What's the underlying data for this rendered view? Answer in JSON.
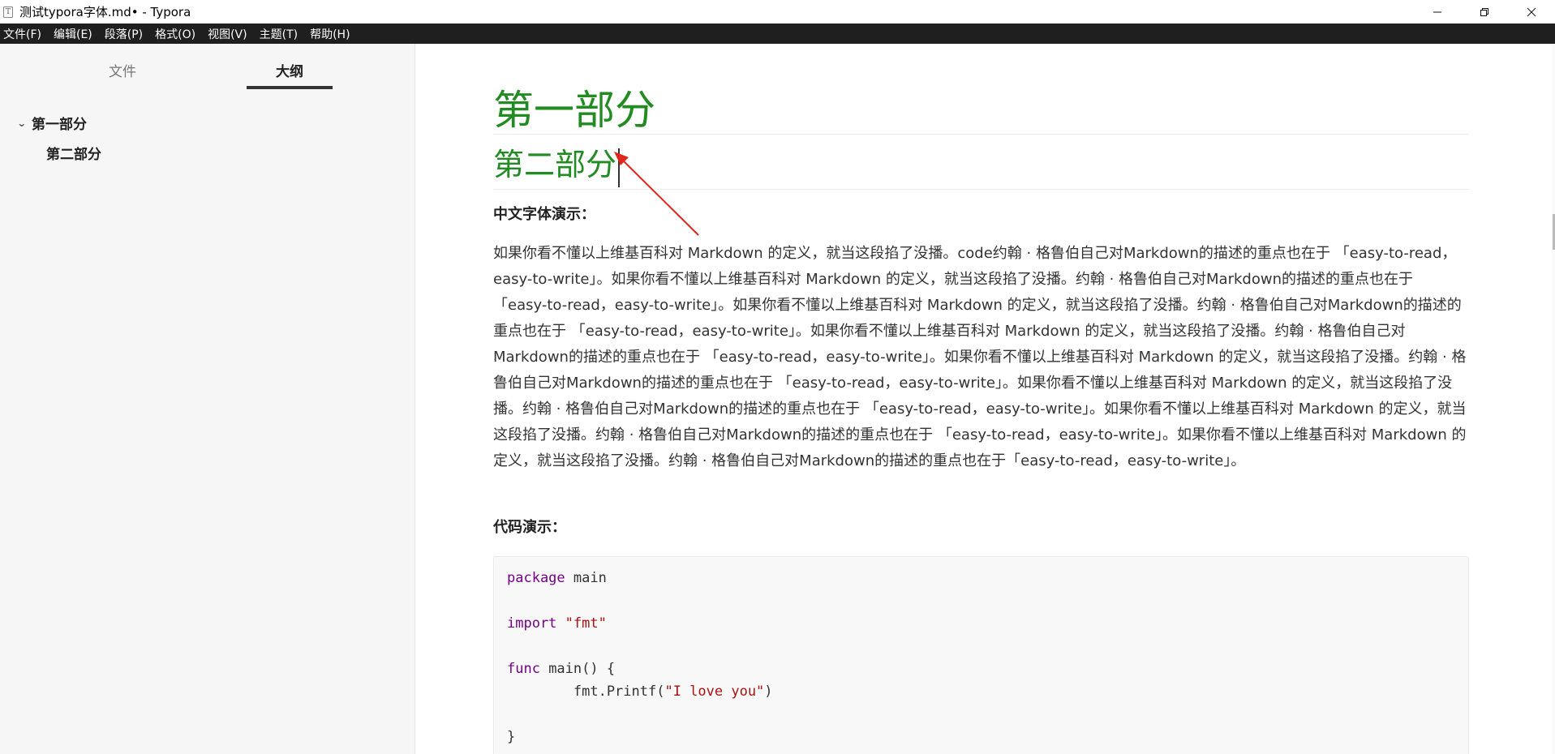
{
  "window": {
    "title": "测试typora字体.md• - Typora",
    "app_icon": "T"
  },
  "menubar": {
    "items": [
      "文件(F)",
      "编辑(E)",
      "段落(P)",
      "格式(O)",
      "视图(V)",
      "主题(T)",
      "帮助(H)"
    ]
  },
  "sidebar": {
    "tabs": {
      "files": "文件",
      "outline": "大纲"
    },
    "outline": [
      {
        "label": "第一部分",
        "expanded": true
      },
      {
        "label": "第二部分"
      }
    ]
  },
  "document": {
    "h1": "第一部分",
    "h2": "第二部分",
    "chinese_label": "中文字体演示：",
    "paragraph": "如果你看不懂以上维基百科对 Markdown 的定义，就当这段掐了没播。code约翰 · 格鲁伯自己对Markdown的描述的重点也在于 「easy-to-read，easy-to-write」。如果你看不懂以上维基百科对 Markdown 的定义，就当这段掐了没播。约翰 · 格鲁伯自己对Markdown的描述的重点也在于 「easy-to-read，easy-to-write」。如果你看不懂以上维基百科对 Markdown 的定义，就当这段掐了没播。约翰 · 格鲁伯自己对Markdown的描述的重点也在于 「easy-to-read，easy-to-write」。如果你看不懂以上维基百科对 Markdown 的定义，就当这段掐了没播。约翰 · 格鲁伯自己对Markdown的描述的重点也在于 「easy-to-read，easy-to-write」。如果你看不懂以上维基百科对 Markdown 的定义，就当这段掐了没播。约翰 · 格鲁伯自己对Markdown的描述的重点也在于 「easy-to-read，easy-to-write」。如果你看不懂以上维基百科对 Markdown 的定义，就当这段掐了没播。约翰 · 格鲁伯自己对Markdown的描述的重点也在于 「easy-to-read，easy-to-write」。如果你看不懂以上维基百科对 Markdown 的定义，就当这段掐了没播。约翰 · 格鲁伯自己对Markdown的描述的重点也在于 「easy-to-read，easy-to-write」。如果你看不懂以上维基百科对 Markdown 的定义，就当这段掐了没播。约翰 · 格鲁伯自己对Markdown的描述的重点也在于「easy-to-read，easy-to-write」。",
    "code_label": "代码演示：",
    "code": {
      "line1_kw": "package",
      "line1_rest": " main",
      "line3_kw": "import",
      "line3_str": "\"fmt\"",
      "line5_kw": "func",
      "line5_rest": " main() {",
      "line6_pre": "        fmt.Printf(",
      "line6_str": "\"I love you\"",
      "line6_post": ")",
      "line8": "}"
    }
  },
  "colors": {
    "heading_green": "#228b22",
    "menubar_bg": "#1f1f1f",
    "sidebar_bg": "#f6f6f6",
    "annotation_red": "#e0261b",
    "code_keyword": "#770088",
    "code_string": "#aa1111"
  },
  "icons": {
    "minimize": "minimize-icon",
    "maximize": "restore-icon",
    "close": "close-icon",
    "outline_caret": "chevron-down-icon"
  }
}
